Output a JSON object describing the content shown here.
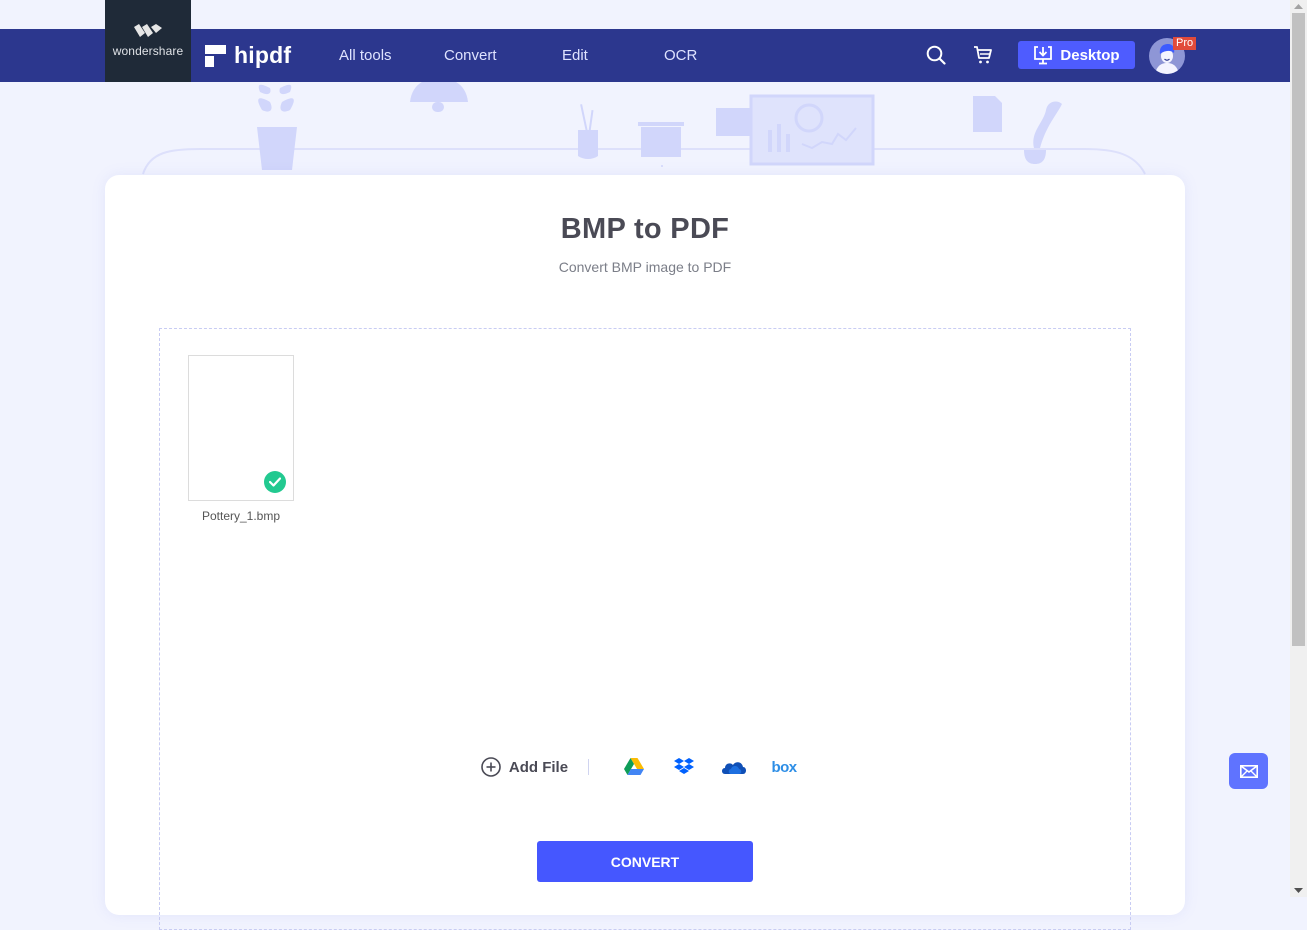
{
  "brand": {
    "wondershare_label": "wondershare",
    "hipdf_label": "hipdf"
  },
  "nav": {
    "items": [
      {
        "label": "All tools"
      },
      {
        "label": "Convert"
      },
      {
        "label": "Edit"
      },
      {
        "label": "OCR"
      }
    ],
    "desktop_label": "Desktop",
    "pro_badge": "Pro"
  },
  "page": {
    "title": "BMP to PDF",
    "subtitle": "Convert BMP image to PDF"
  },
  "upload": {
    "files": [
      {
        "name": "Pottery_1.bmp",
        "status": "uploaded"
      }
    ],
    "add_file_label": "Add File",
    "cloud_sources": [
      "google-drive",
      "dropbox",
      "onedrive",
      "box"
    ],
    "box_label": "box",
    "convert_label": "CONVERT"
  },
  "colors": {
    "navbar": "#2c378e",
    "accent": "#4557ff",
    "success": "#22c990",
    "pro": "#e14b3b"
  }
}
